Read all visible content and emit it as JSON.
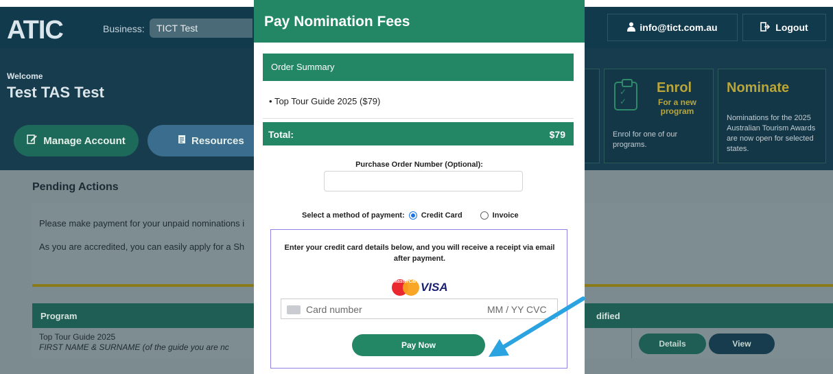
{
  "header": {
    "logo": "ATIC",
    "business_label": "Business:",
    "business_value": "TICT Test",
    "email": "info@tict.com.au",
    "logout": "Logout"
  },
  "hero": {
    "welcome": "Welcome",
    "user_name": "Test TAS Test",
    "manage_account": "Manage Account",
    "resources": "Resources",
    "enrol": {
      "title": "Enrol",
      "subtitle": "For a new program",
      "description": "Enrol for one of our programs."
    },
    "nominate": {
      "title": "Nominate",
      "description": "Nominations for the 2025 Australian Tourism Awards are now open for selected states."
    }
  },
  "pending": {
    "title": "Pending Actions",
    "line1": "Please make payment for your unpaid nominations i",
    "line2": "As you are accredited, you can easily apply for a Sh"
  },
  "table": {
    "col_program": "Program",
    "col_modified": "dified",
    "row": {
      "program": "Top Tour Guide 2025",
      "note": "FIRST NAME & SURNAME (of the guide you are nc",
      "details": "Details",
      "view": "View"
    }
  },
  "modal": {
    "title": "Pay Nomination Fees",
    "order_summary": "Order Summary",
    "item": "Top Tour Guide 2025 ($79)",
    "total_label": "Total:",
    "total_value": "$79",
    "po_label": "Purchase Order Number (Optional):",
    "po_value": "",
    "method_label": "Select a method of payment:",
    "method_credit": "Credit Card",
    "method_invoice": "Invoice",
    "cc_info": "Enter your credit card details below, and you will receive a receipt via email after payment.",
    "mastercard": "MasterCard",
    "visa": "VISA",
    "card_placeholder": "Card number",
    "card_exp": "MM / YY  CVC",
    "pay_now": "Pay Now"
  },
  "colors": {
    "brand_green": "#238765",
    "navy": "#123a4d",
    "arrow": "#2aa3e0"
  }
}
